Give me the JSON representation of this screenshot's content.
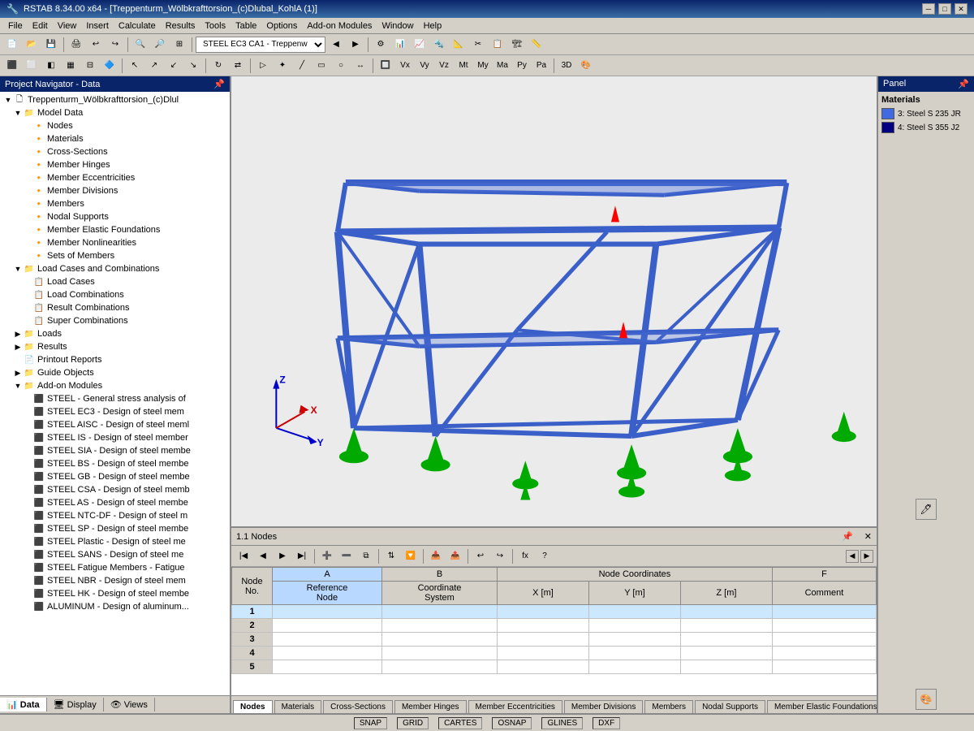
{
  "titleBar": {
    "text": "RSTAB 8.34.00 x64 - [Treppenturm_Wölbkrafttorsion_(c)Dlubal_KohlA (1)]",
    "minimize": "─",
    "maximize": "□",
    "close": "✕"
  },
  "menuBar": {
    "items": [
      "File",
      "Edit",
      "View",
      "Insert",
      "Calculate",
      "Results",
      "Tools",
      "Table",
      "Options",
      "Add-on Modules",
      "Window",
      "Help"
    ]
  },
  "toolbar2": {
    "dropdown": "STEEL EC3 CA1 - Treppenw"
  },
  "navigator": {
    "title": "Project Navigator - Data",
    "root": "Treppenturm_Wölbkrafttorsion_(c)Dlul",
    "items": [
      {
        "id": "model-data",
        "label": "Model Data",
        "level": 1,
        "expanded": true,
        "type": "folder"
      },
      {
        "id": "nodes",
        "label": "Nodes",
        "level": 2,
        "type": "item"
      },
      {
        "id": "materials",
        "label": "Materials",
        "level": 2,
        "type": "item"
      },
      {
        "id": "cross-sections",
        "label": "Cross-Sections",
        "level": 2,
        "type": "item"
      },
      {
        "id": "member-hinges",
        "label": "Member Hinges",
        "level": 2,
        "type": "item"
      },
      {
        "id": "member-eccentricities",
        "label": "Member Eccentricities",
        "level": 2,
        "type": "item"
      },
      {
        "id": "member-divisions",
        "label": "Member Divisions",
        "level": 2,
        "type": "item"
      },
      {
        "id": "members",
        "label": "Members",
        "level": 2,
        "type": "item"
      },
      {
        "id": "nodal-supports",
        "label": "Nodal Supports",
        "level": 2,
        "type": "item"
      },
      {
        "id": "member-elastic-foundations",
        "label": "Member Elastic Foundations",
        "level": 2,
        "type": "item"
      },
      {
        "id": "member-nonlinearities",
        "label": "Member Nonlinearities",
        "level": 2,
        "type": "item"
      },
      {
        "id": "sets-of-members",
        "label": "Sets of Members",
        "level": 2,
        "type": "item"
      },
      {
        "id": "load-cases-combinations",
        "label": "Load Cases and Combinations",
        "level": 1,
        "expanded": true,
        "type": "folder"
      },
      {
        "id": "load-cases",
        "label": "Load Cases",
        "level": 2,
        "type": "item"
      },
      {
        "id": "load-combinations",
        "label": "Load Combinations",
        "level": 2,
        "type": "item"
      },
      {
        "id": "result-combinations",
        "label": "Result Combinations",
        "level": 2,
        "type": "item"
      },
      {
        "id": "super-combinations",
        "label": "Super Combinations",
        "level": 2,
        "type": "item"
      },
      {
        "id": "loads",
        "label": "Loads",
        "level": 1,
        "expanded": false,
        "type": "folder"
      },
      {
        "id": "results",
        "label": "Results",
        "level": 1,
        "expanded": false,
        "type": "folder"
      },
      {
        "id": "printout-reports",
        "label": "Printout Reports",
        "level": 1,
        "expanded": false,
        "type": "item-folder"
      },
      {
        "id": "guide-objects",
        "label": "Guide Objects",
        "level": 1,
        "expanded": false,
        "type": "folder"
      },
      {
        "id": "add-on-modules",
        "label": "Add-on Modules",
        "level": 1,
        "expanded": true,
        "type": "folder"
      },
      {
        "id": "steel-general",
        "label": "STEEL - General stress analysis of",
        "level": 2,
        "type": "addon"
      },
      {
        "id": "steel-ec3",
        "label": "STEEL EC3 - Design of steel mem",
        "level": 2,
        "type": "addon"
      },
      {
        "id": "steel-aisc",
        "label": "STEEL AISC - Design of steel meml",
        "level": 2,
        "type": "addon"
      },
      {
        "id": "steel-is",
        "label": "STEEL IS - Design of steel member",
        "level": 2,
        "type": "addon"
      },
      {
        "id": "steel-sia",
        "label": "STEEL SIA - Design of steel membe",
        "level": 2,
        "type": "addon"
      },
      {
        "id": "steel-bs",
        "label": "STEEL BS - Design of steel membe",
        "level": 2,
        "type": "addon"
      },
      {
        "id": "steel-gb",
        "label": "STEEL GB - Design of steel membe",
        "level": 2,
        "type": "addon"
      },
      {
        "id": "steel-csa",
        "label": "STEEL CSA - Design of steel memb",
        "level": 2,
        "type": "addon"
      },
      {
        "id": "steel-as",
        "label": "STEEL AS - Design of steel membe",
        "level": 2,
        "type": "addon"
      },
      {
        "id": "steel-ntc-df",
        "label": "STEEL NTC-DF - Design of steel m",
        "level": 2,
        "type": "addon"
      },
      {
        "id": "steel-sp",
        "label": "STEEL SP - Design of steel membe",
        "level": 2,
        "type": "addon"
      },
      {
        "id": "steel-plastic",
        "label": "STEEL Plastic - Design of steel me",
        "level": 2,
        "type": "addon"
      },
      {
        "id": "steel-sans",
        "label": "STEEL SANS - Design of steel me",
        "level": 2,
        "type": "addon"
      },
      {
        "id": "steel-fatigue",
        "label": "STEEL Fatigue Members - Fatigue",
        "level": 2,
        "type": "addon"
      },
      {
        "id": "steel-nbr",
        "label": "STEEL NBR - Design of steel mem",
        "level": 2,
        "type": "addon"
      },
      {
        "id": "steel-hk",
        "label": "STEEL HK - Design of steel membe",
        "level": 2,
        "type": "addon"
      },
      {
        "id": "aluminum",
        "label": "ALUMINUM - Design of aluminum...",
        "level": 2,
        "type": "addon"
      }
    ],
    "tabs": [
      {
        "id": "data",
        "label": "Data",
        "active": true
      },
      {
        "id": "display",
        "label": "Display",
        "active": false
      },
      {
        "id": "views",
        "label": "Views",
        "active": false
      }
    ]
  },
  "panel": {
    "title": "Panel",
    "section": "Materials",
    "materials": [
      {
        "id": "mat1",
        "label": "3: Steel S 235 JR",
        "color": "#4169e1"
      },
      {
        "id": "mat2",
        "label": "4: Steel S 355 J2",
        "color": "#000080"
      }
    ]
  },
  "tableArea": {
    "title": "1.1 Nodes",
    "columns": [
      {
        "id": "A",
        "sub1": "Reference",
        "sub2": "Node"
      },
      {
        "id": "B",
        "sub1": "Coordinate",
        "sub2": "System"
      },
      {
        "id": "C",
        "sub1": "Node Coordinates",
        "sub2": "X [m]"
      },
      {
        "id": "D",
        "sub1": "",
        "sub2": "Y [m]"
      },
      {
        "id": "E",
        "sub1": "",
        "sub2": "Z [m]"
      },
      {
        "id": "F",
        "sub1": "Comment",
        "sub2": ""
      }
    ],
    "rows": [
      {
        "num": 1,
        "a": "",
        "b": "",
        "c": "",
        "d": "",
        "e": "",
        "f": "",
        "selected": true
      },
      {
        "num": 2,
        "a": "",
        "b": "",
        "c": "",
        "d": "",
        "e": "",
        "f": ""
      },
      {
        "num": 3,
        "a": "",
        "b": "",
        "c": "",
        "d": "",
        "e": "",
        "f": ""
      },
      {
        "num": 4,
        "a": "",
        "b": "",
        "c": "",
        "d": "",
        "e": "",
        "f": ""
      },
      {
        "num": 5,
        "a": "",
        "b": "",
        "c": "",
        "d": "",
        "e": "",
        "f": ""
      }
    ],
    "tabs": [
      {
        "id": "nodes",
        "label": "Nodes",
        "active": true
      },
      {
        "id": "materials",
        "label": "Materials",
        "active": false
      },
      {
        "id": "cross-sections",
        "label": "Cross-Sections",
        "active": false
      },
      {
        "id": "member-hinges",
        "label": "Member Hinges",
        "active": false
      },
      {
        "id": "member-eccentricities",
        "label": "Member Eccentricities",
        "active": false
      },
      {
        "id": "member-divisions",
        "label": "Member Divisions",
        "active": false
      },
      {
        "id": "members",
        "label": "Members",
        "active": false
      },
      {
        "id": "nodal-supports",
        "label": "Nodal Supports",
        "active": false
      },
      {
        "id": "member-elastic-foundations",
        "label": "Member Elastic Foundations",
        "active": false
      }
    ]
  },
  "statusBar": {
    "items": [
      "SNAP",
      "GRID",
      "CARTES",
      "OSNAP",
      "GLINES",
      "DXF"
    ]
  },
  "colors": {
    "titleBg": "#0a246a",
    "menuBg": "#d4d0c8",
    "steel": "#4169e1",
    "steelDark": "#000080",
    "support": "#00cc00",
    "accent": "#cce8ff"
  }
}
